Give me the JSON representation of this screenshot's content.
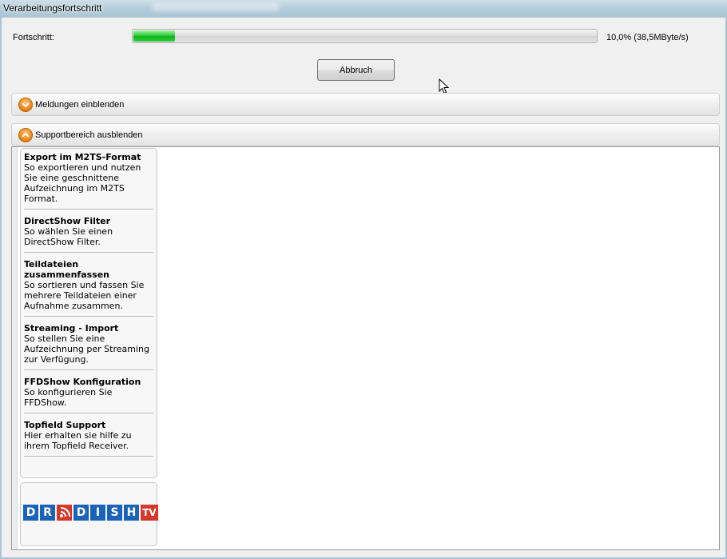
{
  "window": {
    "title": "Verarbeitungsfortschritt"
  },
  "progress": {
    "label": "Fortschritt:",
    "fraction": 0.09,
    "status_text": "10,0% (38,5MByte/s)"
  },
  "buttons": {
    "abort_label": "Abbruch"
  },
  "panels": {
    "messages_label": "Meldungen einblenden",
    "support_label": "Supportbereich ausblenden"
  },
  "support": {
    "items": [
      {
        "title": "Export im M2TS-Format",
        "desc": "So exportieren und nutzen Sie eine geschnittene Aufzeichnung im M2TS Format."
      },
      {
        "title": "DirectShow Filter",
        "desc": "So wählen Sie einen DirectShow Filter."
      },
      {
        "title": "Teildateien zusammenfassen",
        "desc": "So sortieren und fassen Sie mehrere Teildateien einer Aufnahme zusammen."
      },
      {
        "title": "Streaming - Import",
        "desc": "So stellen Sie eine Aufzeichnung per Streaming zur Verfügung."
      },
      {
        "title": "FFDShow Konfiguration",
        "desc": "So konfigurieren Sie FFDShow."
      },
      {
        "title": "Topfield Support",
        "desc": "Hier erhalten sie hilfe zu ihrem Topfield Receiver."
      }
    ],
    "logo": {
      "letters": [
        "D",
        "R",
        "",
        "D",
        "I",
        "S",
        "H"
      ],
      "tv": "TV"
    }
  },
  "icons": {
    "expand": "chevron-down-icon",
    "collapse": "chevron-up-icon",
    "cursor": "mouse-pointer-icon"
  },
  "colors": {
    "progress_green": "#2fcf3a",
    "toggle_orange": "#f08a1d",
    "logo_blue": "#1b63b6",
    "logo_red": "#d33a2c"
  }
}
